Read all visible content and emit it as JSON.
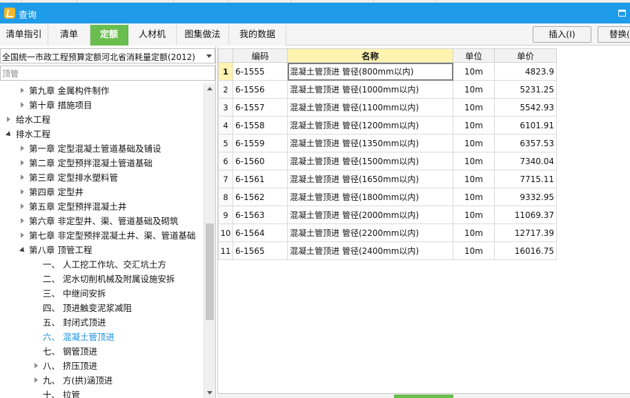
{
  "window": {
    "title": "查询"
  },
  "tabs": [
    {
      "label": "清单指引",
      "active": false
    },
    {
      "label": "清单",
      "active": false
    },
    {
      "label": "定额",
      "active": true
    },
    {
      "label": "人材机",
      "active": false
    },
    {
      "label": "图集做法",
      "active": false
    },
    {
      "label": "我的数据",
      "active": false
    }
  ],
  "toolbar": {
    "insert_label": "插入(I)",
    "replace_label": "替换("
  },
  "left": {
    "quota_library": "全国统一市政工程预算定额河北省消耗量定额(2012)",
    "search_value": "顶管",
    "tree": [
      {
        "label": "第九章 金属构件制作",
        "toggle": "closed",
        "level": 1,
        "selected": false
      },
      {
        "label": "第十章 措施项目",
        "toggle": "closed",
        "level": 1,
        "selected": false
      },
      {
        "label": "给水工程",
        "toggle": "closed",
        "level": 0,
        "selected": false
      },
      {
        "label": "排水工程",
        "toggle": "open",
        "level": 0,
        "selected": false
      },
      {
        "label": "第一章 定型混凝土管道基础及铺设",
        "toggle": "closed",
        "level": 1,
        "selected": false
      },
      {
        "label": "第二章 定型预拌混凝土管道基础",
        "toggle": "closed",
        "level": 1,
        "selected": false
      },
      {
        "label": "第三章 定型排水塑料管",
        "toggle": "closed",
        "level": 1,
        "selected": false
      },
      {
        "label": "第四章 定型井",
        "toggle": "closed",
        "level": 1,
        "selected": false
      },
      {
        "label": "第五章 定型预拌混凝土井",
        "toggle": "closed",
        "level": 1,
        "selected": false
      },
      {
        "label": "第六章 非定型井、渠、管道基础及砌筑",
        "toggle": "closed",
        "level": 1,
        "selected": false
      },
      {
        "label": "第七章 非定型预拌混凝土井、渠、管道基础",
        "toggle": "closed",
        "level": 1,
        "selected": false
      },
      {
        "label": "第八章 顶管工程",
        "toggle": "open",
        "level": 1,
        "selected": false
      },
      {
        "label": "一、 人工挖工作坑、交汇坑土方",
        "toggle": "none",
        "level": 2,
        "selected": false
      },
      {
        "label": "二、 泥水切削机械及附属设施安拆",
        "toggle": "none",
        "level": 2,
        "selected": false
      },
      {
        "label": "三、 中继间安拆",
        "toggle": "none",
        "level": 2,
        "selected": false
      },
      {
        "label": "四、 顶进触变泥浆减阻",
        "toggle": "none",
        "level": 2,
        "selected": false
      },
      {
        "label": "五、 封闭式顶进",
        "toggle": "none",
        "level": 2,
        "selected": false
      },
      {
        "label": "六、 混凝土管顶进",
        "toggle": "none",
        "level": 2,
        "selected": true
      },
      {
        "label": "七、 钢管顶进",
        "toggle": "none",
        "level": 2,
        "selected": false
      },
      {
        "label": "八、 挤压顶进",
        "toggle": "closed",
        "level": 2,
        "selected": false
      },
      {
        "label": "九、 方(拱)涵顶进",
        "toggle": "closed",
        "level": 2,
        "selected": false
      },
      {
        "label": "十、 拉管",
        "toggle": "none",
        "level": 2,
        "selected": false
      }
    ]
  },
  "grid": {
    "headers": {
      "code": "编码",
      "name": "名称",
      "unit": "单位",
      "price": "单价"
    },
    "rows": [
      {
        "num": "1",
        "code": "6-1555",
        "name": "混凝土管顶进 管径(800mm以内)",
        "unit": "10m",
        "price": "4823.9"
      },
      {
        "num": "2",
        "code": "6-1556",
        "name": "混凝土管顶进 管径(1000mm以内)",
        "unit": "10m",
        "price": "5231.25"
      },
      {
        "num": "3",
        "code": "6-1557",
        "name": "混凝土管顶进 管径(1100mm以内)",
        "unit": "10m",
        "price": "5542.93"
      },
      {
        "num": "4",
        "code": "6-1558",
        "name": "混凝土管顶进 管径(1200mm以内)",
        "unit": "10m",
        "price": "6101.91"
      },
      {
        "num": "5",
        "code": "6-1559",
        "name": "混凝土管顶进 管径(1350mm以内)",
        "unit": "10m",
        "price": "6357.53"
      },
      {
        "num": "6",
        "code": "6-1560",
        "name": "混凝土管顶进 管径(1500mm以内)",
        "unit": "10m",
        "price": "7340.04"
      },
      {
        "num": "7",
        "code": "6-1561",
        "name": "混凝土管顶进 管径(1650mm以内)",
        "unit": "10m",
        "price": "7715.11"
      },
      {
        "num": "8",
        "code": "6-1562",
        "name": "混凝土管顶进 管径(1800mm以内)",
        "unit": "10m",
        "price": "9332.95"
      },
      {
        "num": "9",
        "code": "6-1563",
        "name": "混凝土管顶进 管径(2000mm以内)",
        "unit": "10m",
        "price": "11069.37"
      },
      {
        "num": "10",
        "code": "6-1564",
        "name": "混凝土管顶进 管径(2200mm以内)",
        "unit": "10m",
        "price": "12717.39"
      },
      {
        "num": "11",
        "code": "6-1565",
        "name": "混凝土管顶进 管径(2400mm以内)",
        "unit": "10m",
        "price": "16016.75"
      }
    ]
  },
  "colors": {
    "titlebar": "#1e9be9",
    "active_tab": "#6abe4f",
    "selected_tree_text": "#1a8fdc",
    "highlight_header": "#fff3b0"
  }
}
